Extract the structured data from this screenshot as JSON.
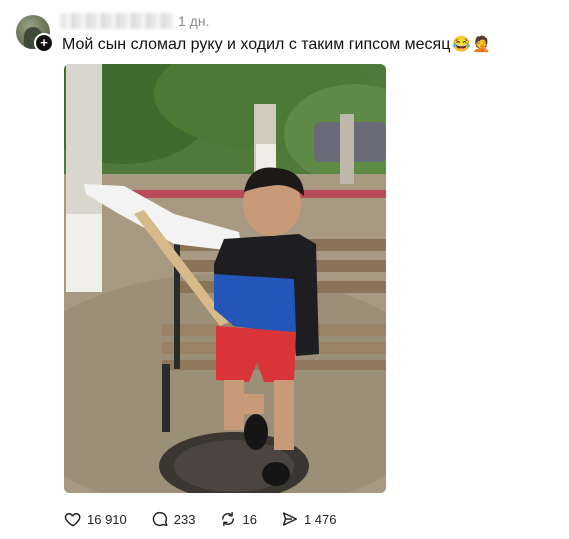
{
  "post": {
    "time": "1 дн.",
    "text": "Мой сын сломал руку и ходил с таким гипсом месяц",
    "emojis": [
      "😂",
      "🤦"
    ],
    "follow_badge": "+"
  },
  "actions": {
    "likes": "16 910",
    "comments": "233",
    "reposts": "16",
    "shares": "1 476"
  },
  "icons": {
    "like": "heart-icon",
    "comment": "comment-bubble-icon",
    "repost": "repost-arrows-icon",
    "share": "paper-plane-icon"
  },
  "colors": {
    "text": "#111111",
    "muted": "#8a8a8a",
    "background": "#ffffff"
  }
}
